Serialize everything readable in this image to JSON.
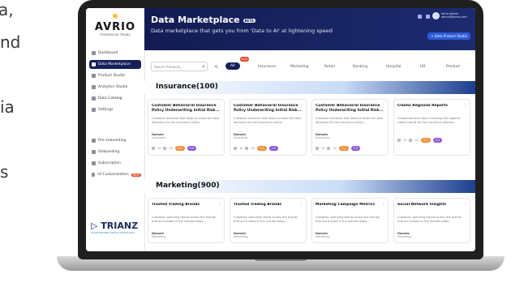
{
  "background_text": [
    "a,",
    "nd",
    "ia",
    "s"
  ],
  "sidebar": {
    "logo_name": "AVRIO",
    "logo_subtitle": "POWERED BY TRIANZ",
    "items": [
      {
        "label": "Dashboard",
        "icon": "grid-icon"
      },
      {
        "label": "Data Marketplace",
        "icon": "store-icon",
        "active": true
      },
      {
        "label": "Product Studio",
        "icon": "box-icon"
      },
      {
        "label": "Analytics Studio",
        "icon": "chart-icon"
      },
      {
        "label": "Data Catalog",
        "icon": "catalog-icon"
      },
      {
        "label": "Settings",
        "icon": "gear-icon"
      }
    ],
    "lower_items": [
      {
        "label": "Pre-onboarding",
        "icon": "upload-icon"
      },
      {
        "label": "Onboarding",
        "icon": "onboard-icon"
      },
      {
        "label": "Subscription",
        "icon": "subscription-icon"
      },
      {
        "label": "UI Customization",
        "icon": "palette-icon",
        "badge": "NEW"
      }
    ],
    "footer_brand": "TRIANZ",
    "footer_tagline": "ACCELERATING DIGITAL EVOLUTION"
  },
  "header": {
    "title": "Data Marketplace",
    "beta": "BETA",
    "subtitle": "Data marketplace that gets you from 'Data to AI' at lightening speed",
    "user_name": "Avrio Admin",
    "user_email": "admin@avrio.com",
    "action_button": "+ Data Product Studio"
  },
  "filters": {
    "search_placeholder": "Search Products...",
    "prev": "<",
    "new_badge": "NEW",
    "tabs": [
      "All",
      "Insurance",
      "Marketing",
      "Retail",
      "Banking",
      "Hospital",
      "HR",
      "Product"
    ]
  },
  "sections": [
    {
      "title": "Insurance(100)",
      "cards": [
        {
          "title": "Customer Behavioral Insurance Policy Underwriting Initial Risk...",
          "desc": "Customer behavior that helps to make the best decisions for the Insurance policy...",
          "domain_label": "Domain",
          "domain": "Insurance",
          "views": "10",
          "likes": "45",
          "pill1": "5.0",
          "pill2": "3.5"
        },
        {
          "title": "Customer Behavioral Insurance Policy Underwriting Initial Risk...",
          "desc": "Customer behavior that helps to make the best decisions for the Insurance policy...",
          "domain_label": "Domain",
          "domain": "Insurance",
          "views": "10",
          "likes": "45",
          "pill1": "5.0",
          "pill2": "3.5"
        },
        {
          "title": "Customer Behavioral Insurance Policy Underwriting Initial Risk...",
          "desc": "Customer behavior that helps to make the best decisions for the Insurance policy...",
          "domain_label": "Domain",
          "domain": "Insurance",
          "views": "10",
          "likes": "45",
          "pill1": "5.0",
          "pill2": "3.5"
        },
        {
          "title": "Claims Regional Reports",
          "desc": "Comprehensive report covering the regional claims trends for the insurance policies...",
          "domain_label": "",
          "domain": "",
          "views": "10",
          "likes": "41",
          "pill1": "5.0",
          "pill2": "3.5"
        }
      ]
    },
    {
      "title": "Marketing(900)",
      "cards": [
        {
          "title": "Trusted Trading Brands",
          "desc": "Customer spending trends across the brands that are trusted in the market today...",
          "domain_label": "Domain",
          "domain": "Marketing"
        },
        {
          "title": "Trusted Trading Brands",
          "desc": "Customer spending trends across the brands that are trusted in the market today...",
          "domain_label": "Domain",
          "domain": "Marketing"
        },
        {
          "title": "Marketing Campaign Metrics",
          "desc": "Customer spending trends across the brands that are trusted in the market today...",
          "domain_label": "Domain",
          "domain": "Marketing"
        },
        {
          "title": "Social Network Insights",
          "desc": "Customer spending trends across the brands that are trusted in the market today...",
          "domain_label": "Domain",
          "domain": "Marketing"
        }
      ]
    }
  ]
}
